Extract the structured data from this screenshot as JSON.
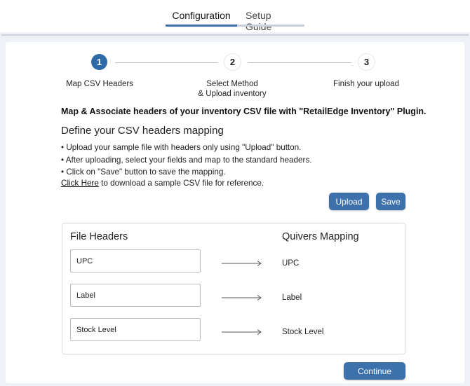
{
  "tabs": [
    {
      "label": "Configuration",
      "active": true
    },
    {
      "label": "Setup Guide",
      "active": false
    }
  ],
  "stepper": {
    "steps": [
      {
        "number": "1",
        "label_line1": "Map CSV Headers",
        "label_line2": ""
      },
      {
        "number": "2",
        "label_line1": "Select Method",
        "label_line2": "& Upload inventory"
      },
      {
        "number": "3",
        "label_line1": "Finish your upload",
        "label_line2": ""
      }
    ],
    "active_step": 1
  },
  "heading": "Map & Associate headers of your inventory CSV file with \"RetailEdge Inventory\" Plugin.",
  "subheading": "Define your CSV headers mapping",
  "bullets": [
    "• Upload your sample file with headers only using \"Upload\" button.",
    "• After uploading, select your fields and map to the standard headers.",
    "• Click on \"Save\" button to save the mapping."
  ],
  "sample_link": {
    "link_text": "Click Here",
    "rest_text": " to download a sample CSV file for reference."
  },
  "buttons": {
    "upload": "Upload",
    "save": "Save",
    "continue": "Continue"
  },
  "mapping": {
    "left_title": "File Headers",
    "right_title": "Quivers Mapping",
    "rows": [
      {
        "field_value": "UPC",
        "mapped_to": "UPC"
      },
      {
        "field_value": "Label",
        "mapped_to": "Label"
      },
      {
        "field_value": "Stock Level",
        "mapped_to": "Stock Level"
      }
    ]
  },
  "colors": {
    "accent": "#3d71ab",
    "active_step": "#2f6aa8",
    "inactive_tab_underline": "#c7d0dc"
  }
}
